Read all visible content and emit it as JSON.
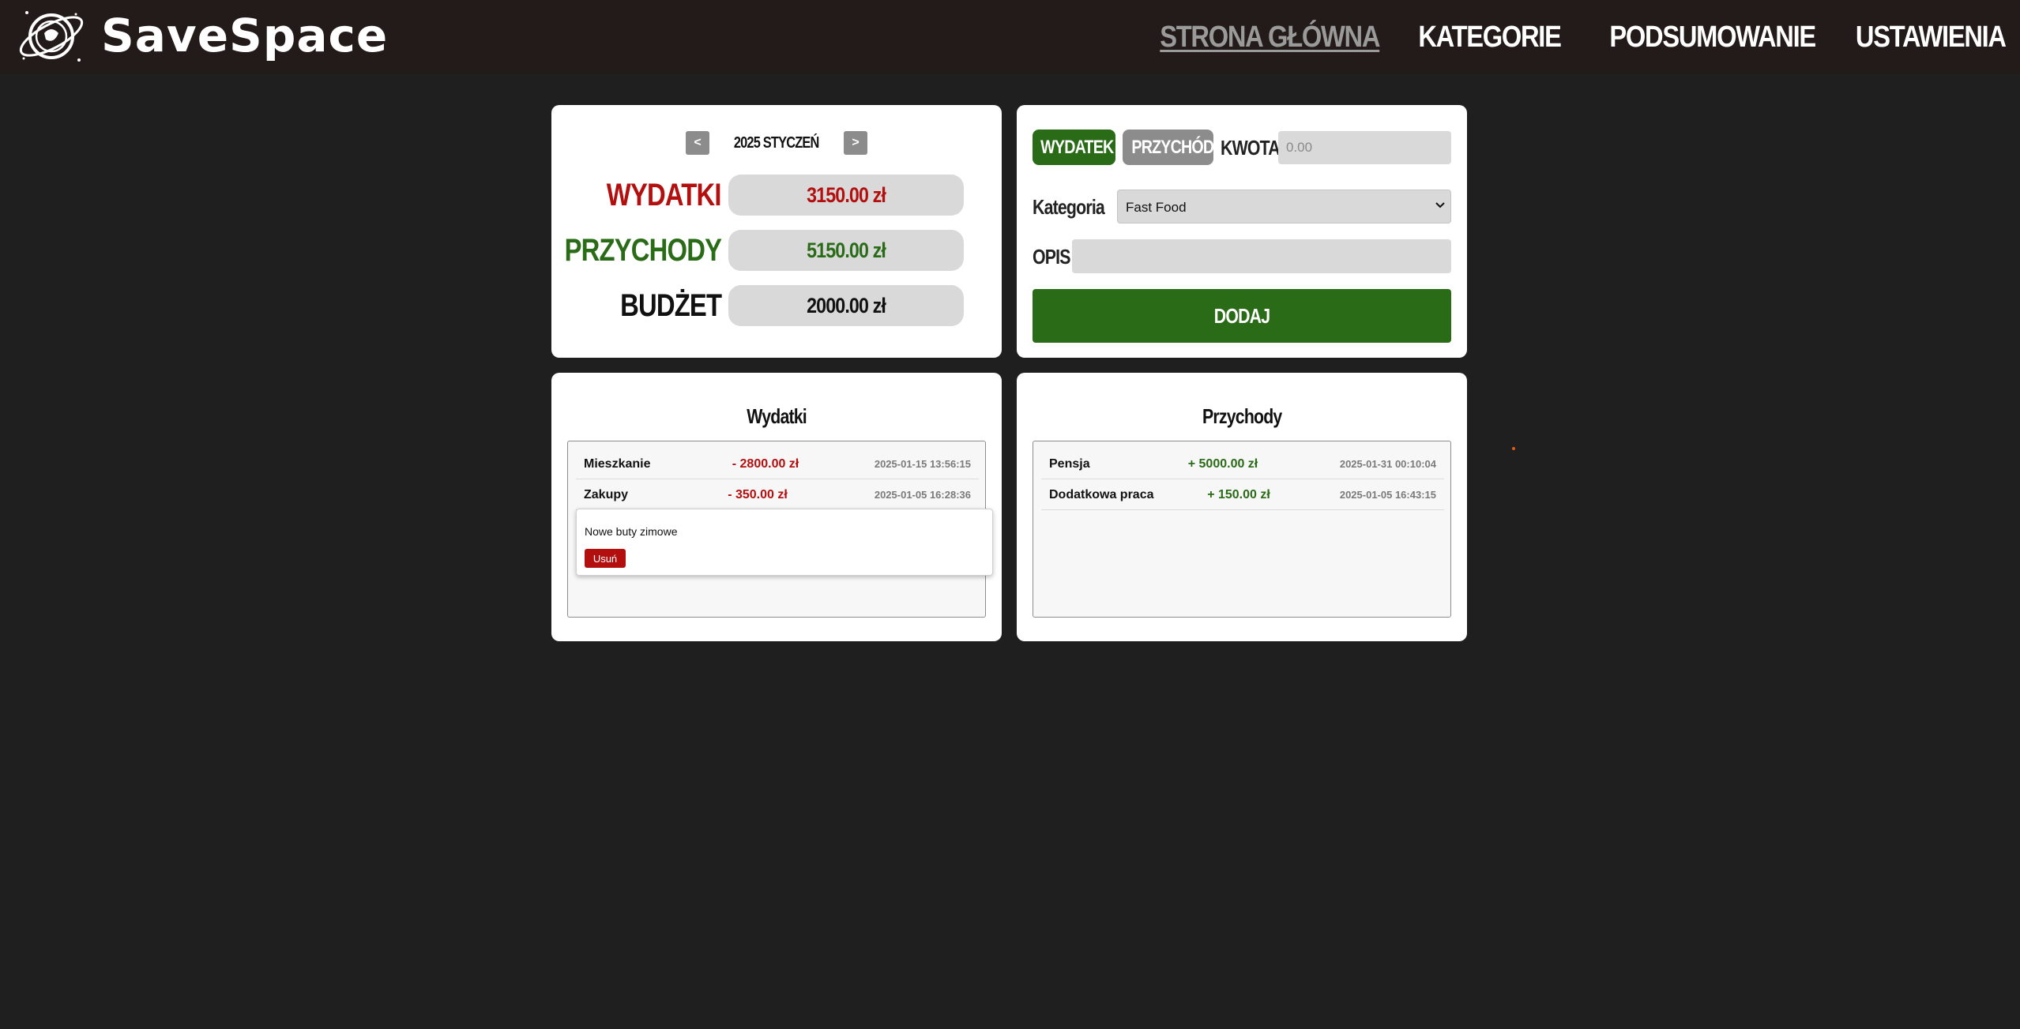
{
  "app": {
    "brand": "SaveSpace",
    "logo_icon": "saturn-planet-icon"
  },
  "nav": {
    "items": [
      {
        "label": "STRONA GŁÓWNA",
        "active": true
      },
      {
        "label": "KATEGORIE",
        "active": false
      },
      {
        "label": "PODSUMOWANIE",
        "active": false
      },
      {
        "label": "USTAWIENIA",
        "active": false
      }
    ]
  },
  "summary": {
    "prev_label": "<",
    "next_label": ">",
    "month_label": "2025 STYCZEŃ",
    "expenses_label": "WYDATKI",
    "expenses_value": "3150.00 zł",
    "income_label": "PRZYCHODY",
    "income_value": "5150.00 zł",
    "budget_label": "BUDŻET",
    "budget_value": "2000.00 zł"
  },
  "form": {
    "expense_button": "WYDATEK",
    "income_button": "PRZYCHÓD",
    "amount_label": "KWOTA",
    "amount_placeholder": "0.00",
    "category_label": "Kategoria",
    "category_selected": "Fast Food",
    "description_label": "OPIS",
    "description_value": "",
    "submit_label": "DODAJ"
  },
  "expenses": {
    "title": "Wydatki",
    "rows": [
      {
        "category": "Mieszkanie",
        "amount": "- 2800.00 zł",
        "date": "2025-01-15 13:56:15"
      },
      {
        "category": "Zakupy",
        "amount": "- 350.00 zł",
        "date": "2025-01-05 16:28:36"
      }
    ],
    "popup": {
      "description": "Nowe buty zimowe",
      "delete_label": "Usuń"
    }
  },
  "income": {
    "title": "Przychody",
    "rows": [
      {
        "category": "Pensja",
        "amount": "+ 5000.00 zł",
        "date": "2025-01-31 00:10:04"
      },
      {
        "category": "Dodatkowa praca",
        "amount": "+ 150.00 zł",
        "date": "2025-01-05 16:43:15"
      }
    ]
  },
  "colors": {
    "background": "#1f1f1f",
    "header": "#231a1a",
    "accent_green": "#2a6b17",
    "expense_red": "#b30f0f",
    "inactive_gray": "#8c8c8c",
    "field_gray": "#d9d9d9"
  }
}
